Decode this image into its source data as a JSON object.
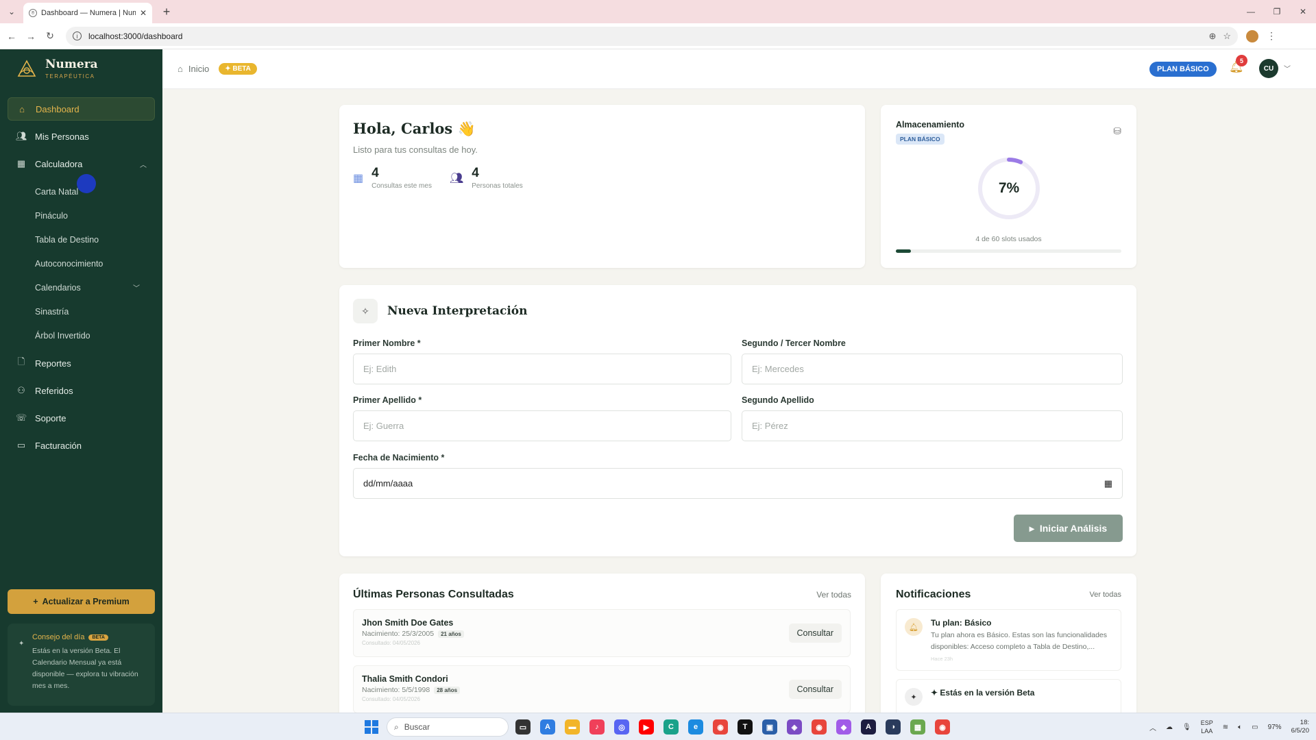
{
  "browser": {
    "tab_title": "Dashboard — Numera | Numer",
    "url": "localhost:3000/dashboard"
  },
  "brand": {
    "name": "Numera",
    "subtitle": "TERAPÉUTICA"
  },
  "sidebar": {
    "items": [
      {
        "label": "Dashboard",
        "icon": "home-icon"
      },
      {
        "label": "Mis Personas",
        "icon": "users-icon"
      },
      {
        "label": "Calculadora",
        "icon": "calculator-icon"
      }
    ],
    "calc_sub": [
      "Carta Natal",
      "Pináculo",
      "Tabla de Destino",
      "Autoconocimiento",
      "Calendarios",
      "Sinastría",
      "Árbol Invertido"
    ],
    "bottom_items": [
      {
        "label": "Reportes",
        "icon": "file-icon"
      },
      {
        "label": "Referidos",
        "icon": "referral-icon"
      },
      {
        "label": "Soporte",
        "icon": "support-icon"
      },
      {
        "label": "Facturación",
        "icon": "card-icon"
      }
    ],
    "upgrade_label": "Actualizar a Premium",
    "tip": {
      "title": "Consejo del día",
      "badge": "BETA",
      "text": "Estás en la versión Beta. El Calendario Mensual ya está disponible — explora tu vibración mes a mes."
    }
  },
  "topbar": {
    "breadcrumb": "Inicio",
    "beta_label": "✦ BETA",
    "plan_label": "PLAN BÁSICO",
    "notif_count": "5",
    "avatar_initials": "CU"
  },
  "greeting": {
    "title": "Hola, Carlos 👋",
    "subtitle": "Listo para tus consultas de hoy.",
    "stats": [
      {
        "value": "4",
        "label": "Consultas este mes"
      },
      {
        "value": "4",
        "label": "Personas totales"
      }
    ]
  },
  "storage": {
    "title": "Almacenamiento",
    "plan_tag": "PLAN BÁSICO",
    "percent_label": "7%",
    "used_fraction": 0.067,
    "slots_text": "4 de 60 slots usados"
  },
  "form": {
    "title": "Nueva Interpretación",
    "fields": {
      "first_name": {
        "label": "Primer Nombre *",
        "placeholder": "Ej: Edith"
      },
      "middle_name": {
        "label": "Segundo / Tercer Nombre",
        "placeholder": "Ej: Mercedes"
      },
      "last_name": {
        "label": "Primer Apellido *",
        "placeholder": "Ej: Guerra"
      },
      "second_last_name": {
        "label": "Segundo Apellido",
        "placeholder": "Ej: Pérez"
      },
      "birth_date": {
        "label": "Fecha de Nacimiento *",
        "value": "dd/mm/aaaa"
      }
    },
    "submit_label": "Iniciar Análisis"
  },
  "recent": {
    "title": "Últimas Personas Consultadas",
    "view_all": "Ver todas",
    "people": [
      {
        "name": "Jhon Smith Doe Gates",
        "birth": "Nacimiento: 25/3/2005",
        "age": "21 años",
        "consulted": "Consultado: 04/05/2026",
        "action": "Consultar"
      },
      {
        "name": "Thalia Smith Condori",
        "birth": "Nacimiento: 5/5/1998",
        "age": "28 años",
        "consulted": "Consultado: 04/05/2026",
        "action": "Consultar"
      }
    ]
  },
  "notifications": {
    "title": "Notificaciones",
    "view_all": "Ver todas",
    "items": [
      {
        "title": "Tu plan: Básico",
        "body": "Tu plan ahora es Básico. Estas son las funcionalidades disponibles: Acceso completo a Tabla de Destino,...",
        "time": "Hace 23h"
      },
      {
        "title": "✦ Estás en la versión Beta",
        "body": "",
        "time": ""
      }
    ]
  },
  "taskbar": {
    "search_placeholder": "Buscar",
    "lang": "ESP",
    "lang2": "LAA",
    "battery": "97%",
    "time": "18:",
    "date": "6/5/20"
  },
  "colors": {
    "sidebar_bg": "#173a2e",
    "accent_gold": "#d3a13d",
    "plan_blue": "#2a6fd0",
    "ring_purple": "#9b7be6"
  }
}
